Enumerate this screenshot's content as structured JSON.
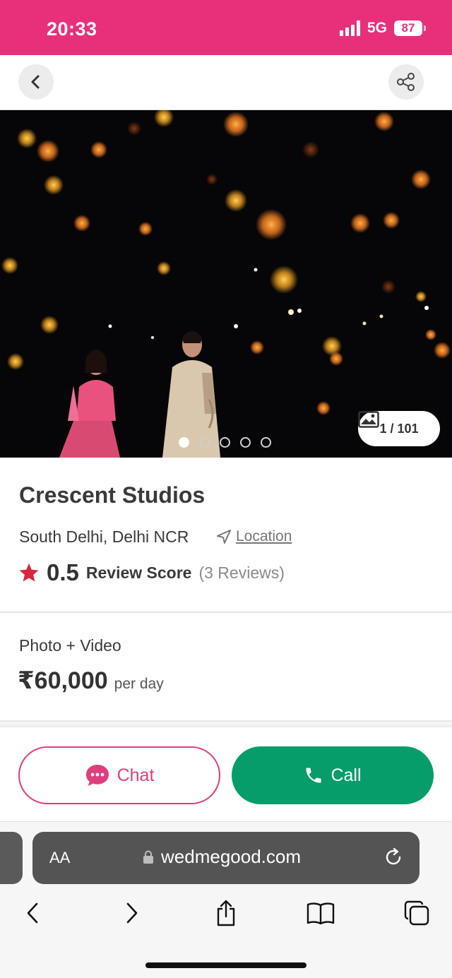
{
  "status_bar": {
    "time": "20:33",
    "network": "5G",
    "battery": "87"
  },
  "nav": {
    "back_icon": "chevron-left-icon",
    "share_icon": "share-icon"
  },
  "gallery": {
    "counter": "1 / 101",
    "dot_count": 5,
    "active_dot": 1
  },
  "vendor": {
    "name": "Crescent Studios",
    "location": "South Delhi, Delhi NCR",
    "location_link": "Location",
    "rating": "0.5",
    "rating_label": "Review Score",
    "review_count": "(3 Reviews)"
  },
  "pricing": {
    "package": "Photo + Video",
    "price": "₹60,000",
    "unit": "per day"
  },
  "actions": {
    "chat": "Chat",
    "call": "Call"
  },
  "browser": {
    "text_size": "AA",
    "url": "wedmegood.com"
  },
  "colors": {
    "brand": "#e8307a",
    "chat": "#e13d7c",
    "call": "#079d6b",
    "star": "#d7263d"
  }
}
